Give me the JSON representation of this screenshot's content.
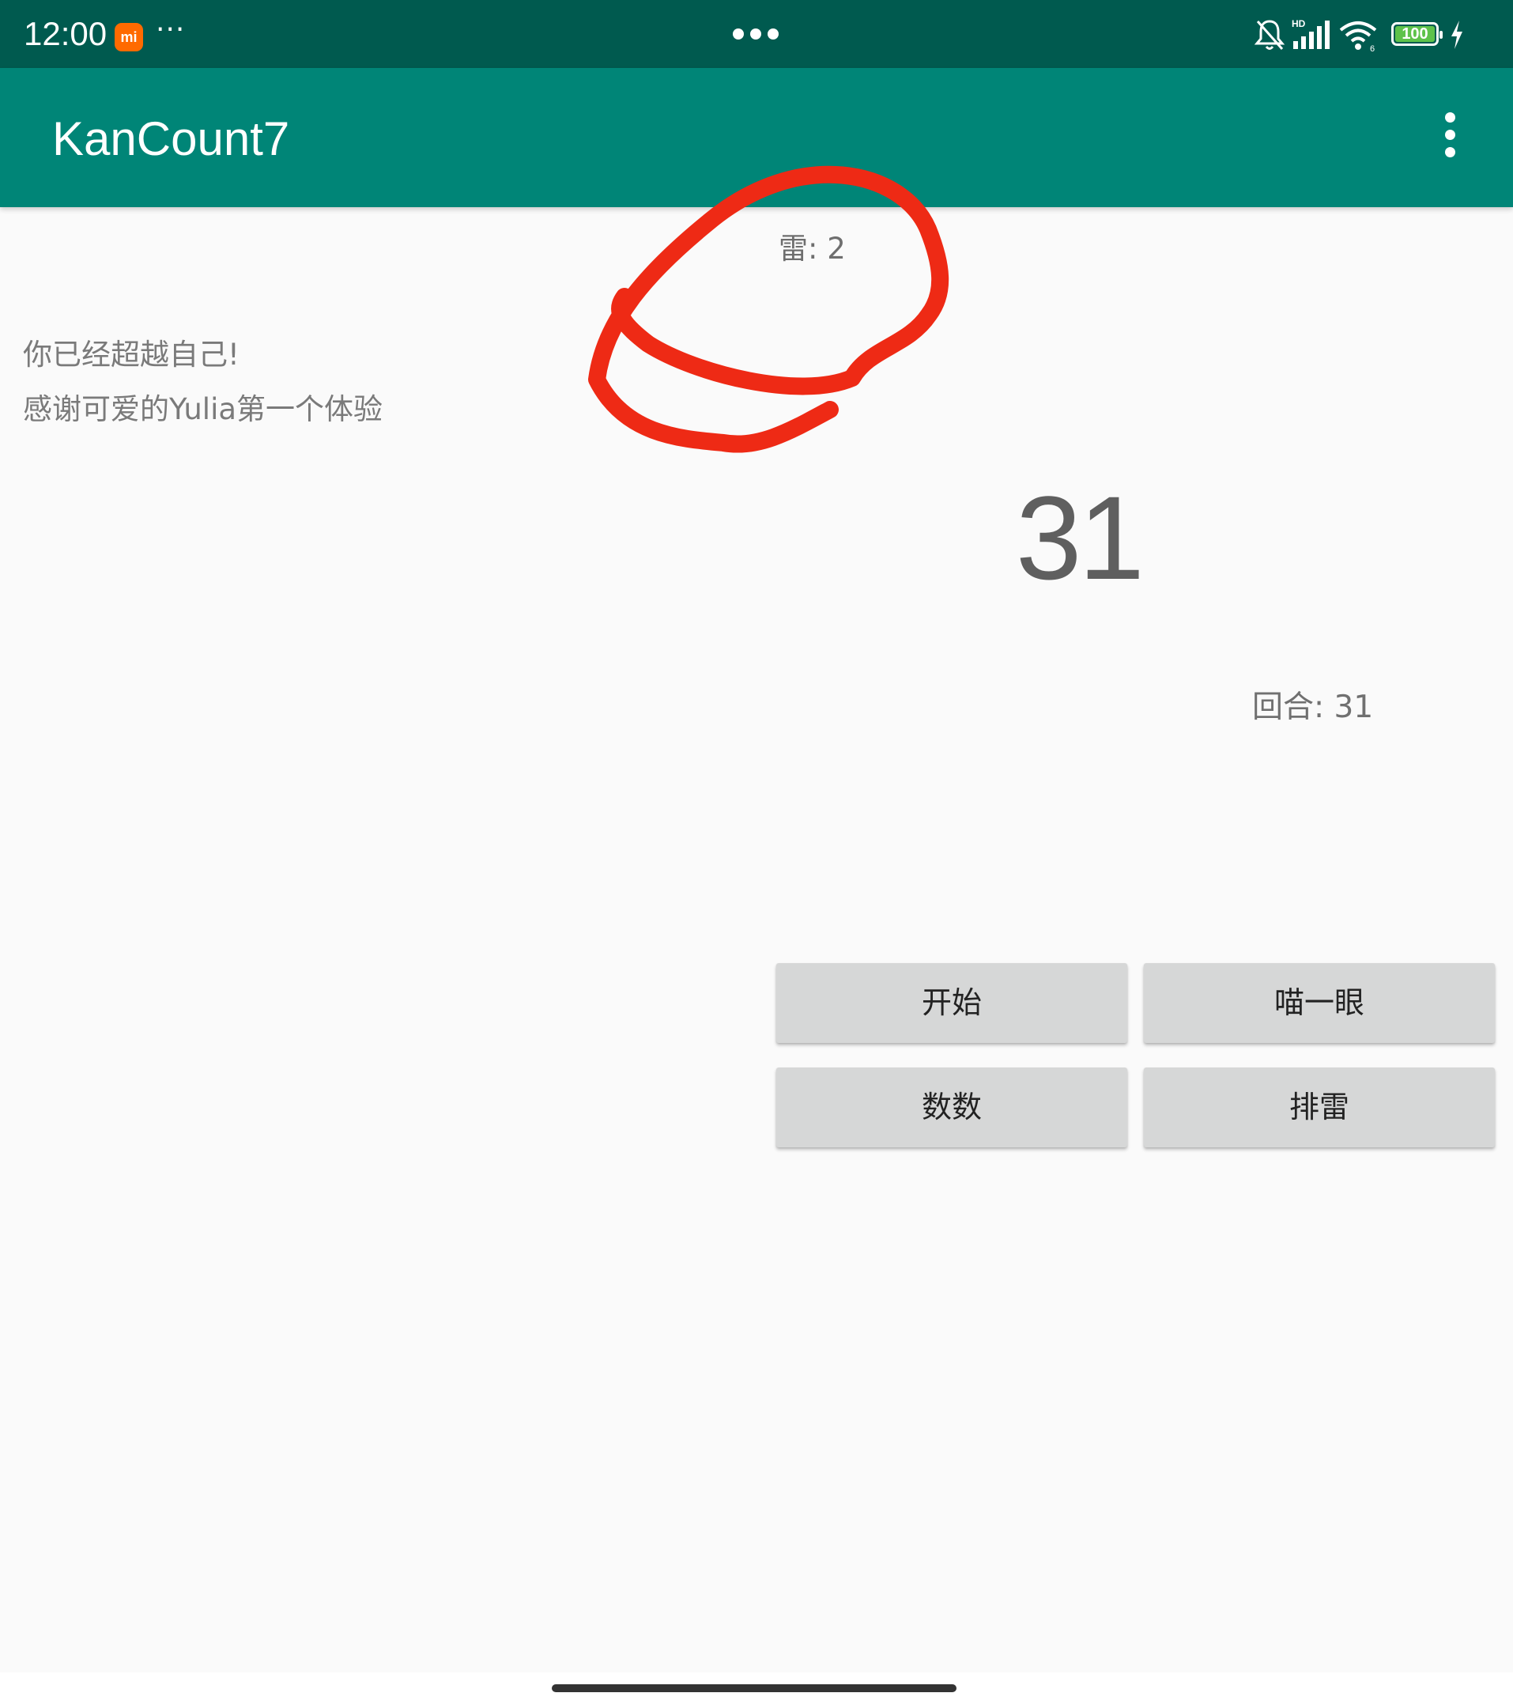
{
  "status_bar": {
    "time": "12:00",
    "mi_badge": "mi",
    "more_indicator": "···",
    "battery": "100",
    "icons": [
      "bell-muted-icon",
      "hd-signal-icon",
      "wifi-icon",
      "battery-icon",
      "charging-icon"
    ],
    "background_color": "#005a4f"
  },
  "app_bar": {
    "title": "KanCount7",
    "overflow_icon": "more-vert-icon",
    "background_color": "#008577"
  },
  "content": {
    "mine_label": "雷: 2",
    "message_line1": "你已经超越自己!",
    "message_line2": "感谢可爱的Yulia第一个体验",
    "count": "31",
    "round_label": "回合: 31"
  },
  "buttons": {
    "start": "开始",
    "peek": "喵一眼",
    "count": "数数",
    "sweep": "排雷"
  },
  "annotation": {
    "color": "#ee2a15"
  }
}
